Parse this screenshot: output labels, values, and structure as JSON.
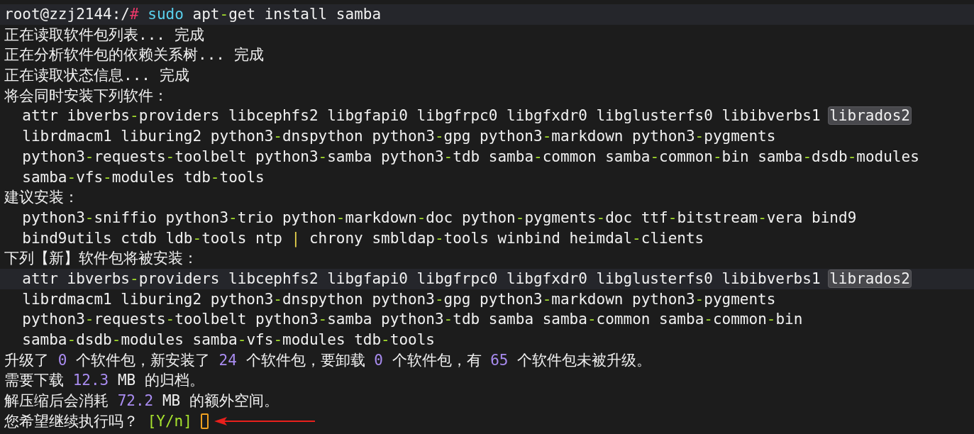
{
  "terminal": {
    "lines": [
      {
        "highlighted": true,
        "cursor": false,
        "segments": [
          {
            "kind": "plain",
            "text": "root@zzj2144:/"
          },
          {
            "kind": "hash",
            "text": "#"
          },
          {
            "kind": "command",
            "text": " sudo"
          },
          {
            "kind": "plain",
            "text": " apt-get install samba"
          }
        ]
      },
      {
        "highlighted": false,
        "cursor": false,
        "segments": [
          {
            "kind": "plain",
            "text": "正在读取软件包列表... 完成"
          }
        ]
      },
      {
        "highlighted": false,
        "cursor": false,
        "segments": [
          {
            "kind": "plain",
            "text": "正在分析软件包的依赖关系树... 完成"
          }
        ]
      },
      {
        "highlighted": false,
        "cursor": false,
        "segments": [
          {
            "kind": "plain",
            "text": "正在读取状态信息... 完成"
          }
        ]
      },
      {
        "highlighted": false,
        "cursor": false,
        "segments": [
          {
            "kind": "plain",
            "text": "将会同时安装下列软件："
          }
        ]
      },
      {
        "highlighted": false,
        "cursor": false,
        "segments": [
          {
            "kind": "plain",
            "text": "  attr ibverbs-providers libcephfs2 libgfapi0 libgfrpc0 libgfxdr0 libglusterfs0 libibverbs1 "
          },
          {
            "kind": "match",
            "text": "librados2"
          }
        ]
      },
      {
        "highlighted": false,
        "cursor": false,
        "segments": [
          {
            "kind": "plain",
            "text": "  librdmacm1 liburing2 python3-dnspython python3-gpg python3-markdown python3-pygments"
          }
        ]
      },
      {
        "highlighted": false,
        "cursor": false,
        "segments": [
          {
            "kind": "plain",
            "text": "  python3-requests-toolbelt python3-samba python3-tdb samba-common samba-common-bin samba-dsdb-modules"
          }
        ]
      },
      {
        "highlighted": false,
        "cursor": false,
        "segments": [
          {
            "kind": "plain",
            "text": "  samba-vfs-modules tdb-tools"
          }
        ]
      },
      {
        "highlighted": false,
        "cursor": false,
        "segments": [
          {
            "kind": "plain",
            "text": "建议安装："
          }
        ]
      },
      {
        "highlighted": false,
        "cursor": false,
        "segments": [
          {
            "kind": "plain",
            "text": "  python3-sniffio python3-trio python-markdown-doc python-pygments-doc ttf-bitstream-vera bind9"
          }
        ]
      },
      {
        "highlighted": false,
        "cursor": false,
        "segments": [
          {
            "kind": "plain",
            "text": "  bind9utils ctdb ldb-tools ntp "
          },
          {
            "kind": "pipe",
            "text": "|"
          },
          {
            "kind": "plain",
            "text": " chrony smbldap-tools winbind heimdal-clients"
          }
        ]
      },
      {
        "highlighted": false,
        "cursor": false,
        "segments": [
          {
            "kind": "plain",
            "text": "下列【新】软件包将被安装："
          }
        ]
      },
      {
        "highlighted": true,
        "cursor": false,
        "segments": [
          {
            "kind": "plain",
            "text": "  attr ibverbs-providers libcephfs2 libgfapi0 libgfrpc0 libgfxdr0 libglusterfs0 libibverbs1 "
          },
          {
            "kind": "match",
            "text": "librados2"
          }
        ]
      },
      {
        "highlighted": false,
        "cursor": false,
        "segments": [
          {
            "kind": "plain",
            "text": "  librdmacm1 liburing2 python3-dnspython python3-gpg python3-markdown python3-pygments"
          }
        ]
      },
      {
        "highlighted": false,
        "cursor": false,
        "segments": [
          {
            "kind": "plain",
            "text": "  python3-requests-toolbelt python3-samba python3-tdb samba samba-common samba-common-bin"
          }
        ]
      },
      {
        "highlighted": false,
        "cursor": false,
        "segments": [
          {
            "kind": "plain",
            "text": "  samba-dsdb-modules samba-vfs-modules tdb-tools"
          }
        ]
      },
      {
        "highlighted": false,
        "cursor": false,
        "segments": [
          {
            "kind": "plain",
            "text": "升级了 "
          },
          {
            "kind": "number",
            "text": "0"
          },
          {
            "kind": "plain",
            "text": " 个软件包，新安装了 "
          },
          {
            "kind": "number",
            "text": "24"
          },
          {
            "kind": "plain",
            "text": " 个软件包，要卸载 "
          },
          {
            "kind": "number",
            "text": "0"
          },
          {
            "kind": "plain",
            "text": " 个软件包，有 "
          },
          {
            "kind": "number",
            "text": "65"
          },
          {
            "kind": "plain",
            "text": " 个软件包未被升级。"
          }
        ]
      },
      {
        "highlighted": false,
        "cursor": false,
        "segments": [
          {
            "kind": "plain",
            "text": "需要下载 "
          },
          {
            "kind": "number",
            "text": "12.3"
          },
          {
            "kind": "plain",
            "text": " MB 的归档。"
          }
        ]
      },
      {
        "highlighted": false,
        "cursor": false,
        "segments": [
          {
            "kind": "plain",
            "text": "解压缩后会消耗 "
          },
          {
            "kind": "number",
            "text": "72.2"
          },
          {
            "kind": "plain",
            "text": " MB 的额外空间。"
          }
        ]
      },
      {
        "highlighted": false,
        "cursor": true,
        "segments": [
          {
            "kind": "plain",
            "text": "您希望继续执行吗？ "
          },
          {
            "kind": "bracket",
            "text": "[Y/n]"
          }
        ]
      }
    ]
  }
}
